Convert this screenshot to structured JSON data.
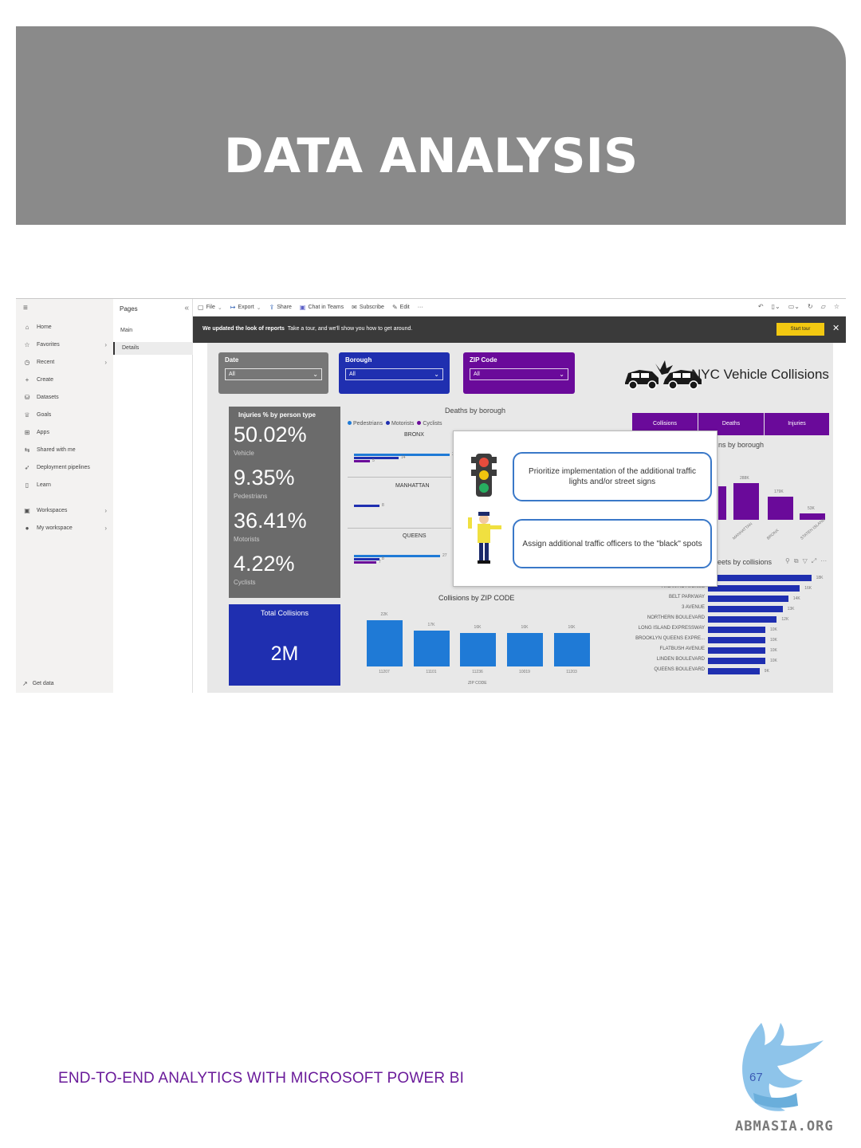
{
  "banner": {
    "title": "DATA ANALYSIS"
  },
  "screenshot": {
    "leftnav": {
      "items": [
        {
          "label": "Home",
          "icon": "home-icon",
          "glyph": "⌂"
        },
        {
          "label": "Favorites",
          "icon": "star-icon",
          "glyph": "☆",
          "chevron": true
        },
        {
          "label": "Recent",
          "icon": "clock-icon",
          "glyph": "◷",
          "chevron": true
        },
        {
          "label": "Create",
          "icon": "plus-icon",
          "glyph": "+"
        },
        {
          "label": "Datasets",
          "icon": "dataset-icon",
          "glyph": "⛁"
        },
        {
          "label": "Goals",
          "icon": "trophy-icon",
          "glyph": "♕"
        },
        {
          "label": "Apps",
          "icon": "apps-icon",
          "glyph": "⊞"
        },
        {
          "label": "Shared with me",
          "icon": "share-icon",
          "glyph": "⇆"
        },
        {
          "label": "Deployment pipelines",
          "icon": "rocket-icon",
          "glyph": "➶"
        },
        {
          "label": "Learn",
          "icon": "book-icon",
          "glyph": "▯"
        },
        {
          "label": "Workspaces",
          "icon": "workspaces-icon",
          "glyph": "▣",
          "chevron": true
        },
        {
          "label": "My workspace",
          "icon": "user-icon",
          "glyph": "●",
          "chevron": true
        }
      ],
      "get_data": "Get data"
    },
    "pages": {
      "title": "Pages",
      "items": [
        "Main",
        "Details"
      ],
      "active": "Details"
    },
    "toolbar": {
      "items": [
        "File",
        "Export",
        "Share",
        "Chat in Teams",
        "Subscribe",
        "Edit",
        "···"
      ]
    },
    "notice": {
      "bold": "We updated the look of reports",
      "text": "Take a tour, and we'll show you how to get around.",
      "button": "Start tour"
    },
    "report": {
      "title": "NYC Vehicle Collisions",
      "slicers": [
        {
          "title": "Date",
          "value": "All",
          "color": "#777777"
        },
        {
          "title": "Borough",
          "value": "All",
          "color": "#1f2fb0"
        },
        {
          "title": "ZIP Code",
          "value": "All",
          "color": "#6a0a9a"
        }
      ],
      "injuries": {
        "title": "Injuries % by person type",
        "items": [
          {
            "value": "50.02%",
            "label": "Vehicle"
          },
          {
            "value": "9.35%",
            "label": "Pedestrians"
          },
          {
            "value": "36.41%",
            "label": "Motorists"
          },
          {
            "value": "4.22%",
            "label": "Cyclists"
          }
        ]
      },
      "total": {
        "title": "Total Collisions",
        "value": "2M"
      },
      "deaths_chart": {
        "title": "Deaths by borough",
        "legend": [
          "Pedestrians",
          "Motorists",
          "Cyclists"
        ],
        "legend_colors": [
          "#1f7ad6",
          "#1f2fb0",
          "#6a0a9a"
        ],
        "boroughs": [
          {
            "name": "BRONX",
            "values": [
              32,
              14,
              5
            ]
          },
          {
            "name": "MANHATTAN",
            "values": [
              8
            ]
          },
          {
            "name": "QUEENS",
            "values": [
              27,
              8,
              7
            ]
          }
        ]
      },
      "tabs": [
        "Collisions",
        "Deaths",
        "Injuries"
      ],
      "injuries_by_borough": {
        "title": "ns by borough",
        "values": [
          "288K",
          "179K",
          "53K"
        ],
        "labels": [
          "MANHATTAN",
          "BRONX",
          "STATEN ISLAND"
        ]
      },
      "recommendations": [
        "Prioritize implementation of the additional traffic lights and/or street signs",
        "Assign additional traffic officers to the \"black\" spots"
      ],
      "zip_chart": {
        "title": "Collisions by ZIP CODE",
        "axis": "ZIP CODE",
        "categories": [
          "11207",
          "11101",
          "11236",
          "10019",
          "11203"
        ],
        "values": [
          22,
          17,
          16,
          16,
          16
        ],
        "value_labels": [
          "22K",
          "17K",
          "16K",
          "16K",
          "16K"
        ]
      },
      "streets": {
        "title": "eets by collisions",
        "items": [
          {
            "name": "",
            "value": 18,
            "label": "18K"
          },
          {
            "name": "ATLANTIC AVENUE",
            "value": 16,
            "label": "16K"
          },
          {
            "name": "BELT PARKWAY",
            "value": 14,
            "label": "14K"
          },
          {
            "name": "3 AVENUE",
            "value": 13,
            "label": "13K"
          },
          {
            "name": "NORTHERN BOULEVARD",
            "value": 12,
            "label": "12K"
          },
          {
            "name": "LONG ISLAND EXPRESSWAY",
            "value": 10,
            "label": "10K"
          },
          {
            "name": "BROOKLYN QUEENS EXPRE...",
            "value": 10,
            "label": "10K"
          },
          {
            "name": "FLATBUSH AVENUE",
            "value": 10,
            "label": "10K"
          },
          {
            "name": "LINDEN BOULEVARD",
            "value": 10,
            "label": "10K"
          },
          {
            "name": "QUEENS BOULEVARD",
            "value": 9,
            "label": "9K"
          }
        ]
      }
    }
  },
  "footer": {
    "text": "END-TO-END ANALYTICS WITH MICROSOFT POWER BI",
    "page": "67",
    "logo_text": "ABMASIA.ORG"
  }
}
